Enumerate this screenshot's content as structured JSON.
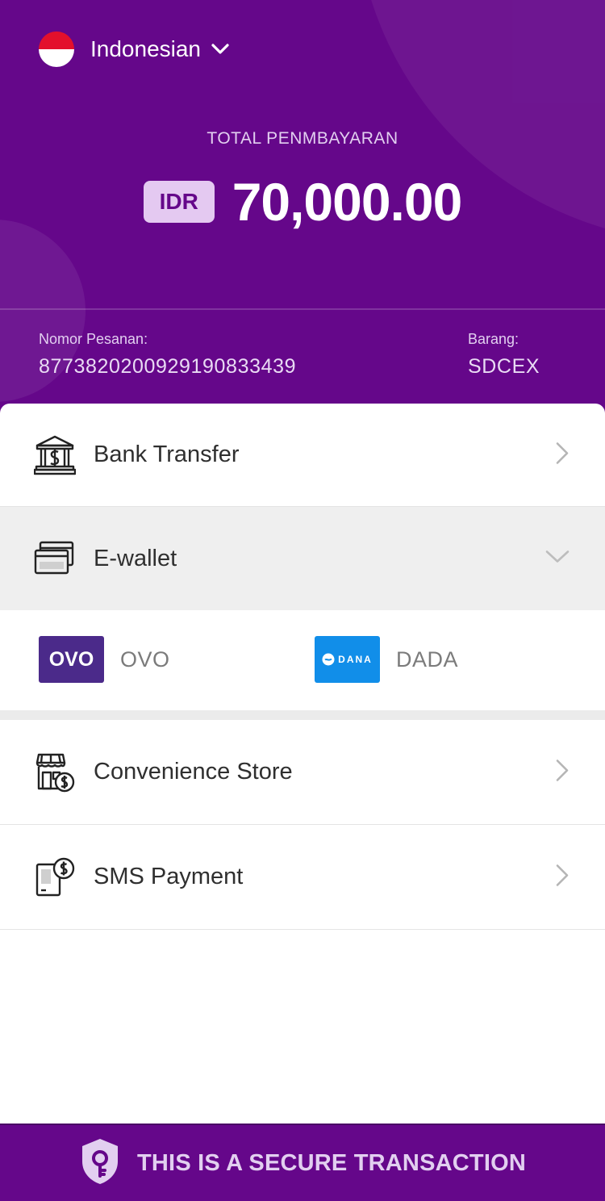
{
  "language": {
    "label": "Indonesian"
  },
  "payment": {
    "total_label": "TOTAL PENMBAYARAN",
    "currency": "IDR",
    "amount": "70,000.00"
  },
  "order": {
    "number_label": "Nomor Pesanan:",
    "number_value": "87738202009291908334 39",
    "item_label": "Barang:",
    "item_value": "SDCEX"
  },
  "methods": {
    "bank_transfer": "Bank Transfer",
    "ewallet": "E-wallet",
    "convenience_store": "Convenience Store",
    "sms_payment": "SMS Payment"
  },
  "ewallet_options": [
    {
      "logo_text": "OVO",
      "label": "OVO"
    },
    {
      "logo_text": "DANA",
      "label": "DADA"
    }
  ],
  "footer": {
    "secure_text": "THIS IS A SECURE TRANSACTION"
  },
  "colors": {
    "brand_purple": "#65078a",
    "badge": "#e4c9f1",
    "ovo": "#4b2a8a",
    "dana": "#118ee9"
  }
}
